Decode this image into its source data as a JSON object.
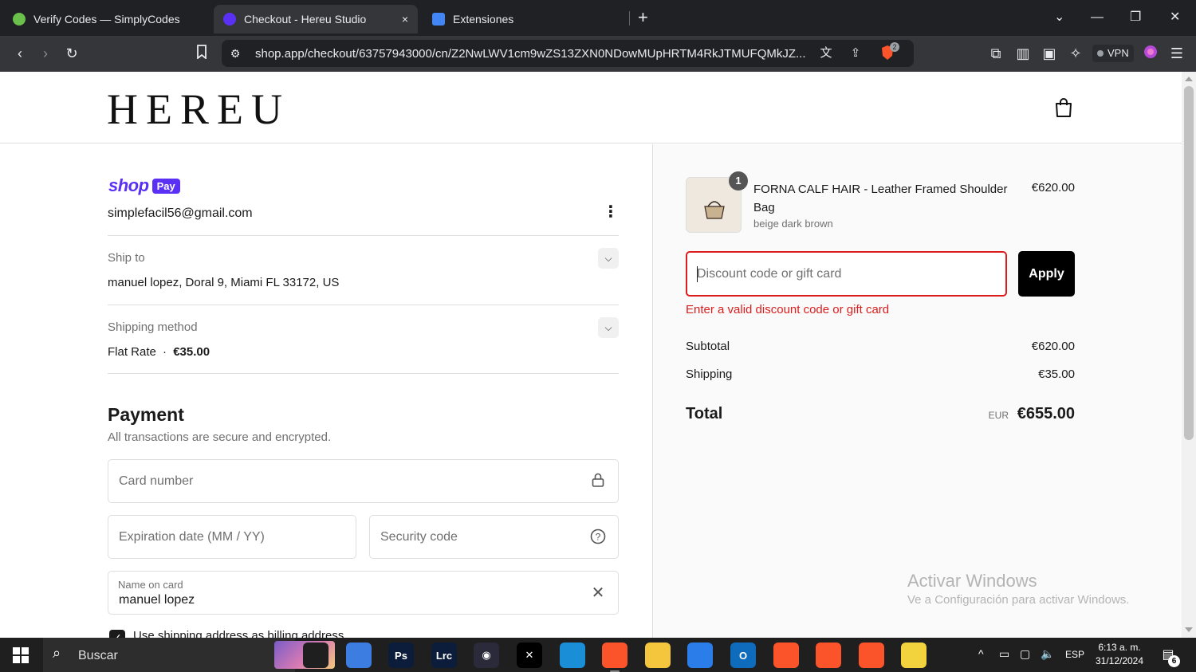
{
  "browser": {
    "tabs": [
      {
        "title": "Verify Codes — SimplyCodes",
        "active": false,
        "favicon_color": "#6bc04b"
      },
      {
        "title": "Checkout - Hereu Studio",
        "active": true,
        "favicon_color": "#5a31f4"
      },
      {
        "title": "Extensiones",
        "active": false,
        "favicon_color": "#4285f4"
      }
    ],
    "tab_close_icon": "×",
    "new_tab_icon": "+",
    "url": "shop.app/checkout/63757943000/cn/Z2NwLWV1cm9wZS13ZXN0NDowMUpHRTM4RkJTMUFQMkJZ...",
    "vpn_label": "VPN",
    "brave_badge": "2"
  },
  "site": {
    "logo": "HEREU"
  },
  "checkout": {
    "shop_pay": {
      "word": "shop",
      "pay": "Pay"
    },
    "email": "simplefacil56@gmail.com",
    "ship_to": {
      "label": "Ship to",
      "value": "manuel lopez, Doral 9, Miami FL 33172, US"
    },
    "shipping_method": {
      "label": "Shipping method",
      "name": "Flat Rate",
      "separator": "·",
      "price": "€35.00"
    },
    "payment": {
      "title": "Payment",
      "subtitle": "All transactions are secure and encrypted.",
      "card_number_placeholder": "Card number",
      "expiration_placeholder": "Expiration date (MM / YY)",
      "security_code_placeholder": "Security code",
      "name_label": "Name on card",
      "name_value": "manuel lopez",
      "billing_checkbox_label": "Use shipping address as billing address",
      "billing_checked": true
    }
  },
  "summary": {
    "item": {
      "quantity": "1",
      "title": "FORNA CALF HAIR - Leather Framed Shoulder Bag",
      "variant": "beige dark brown",
      "price": "€620.00"
    },
    "discount_placeholder": "Discount code or gift card",
    "apply_label": "Apply",
    "error": "Enter a valid discount code or gift card",
    "subtotal_label": "Subtotal",
    "subtotal_value": "€620.00",
    "shipping_label": "Shipping",
    "shipping_value": "€35.00",
    "total_label": "Total",
    "total_currency": "EUR",
    "total_value": "€655.00"
  },
  "watermark": {
    "line1": "Activar Windows",
    "line2": "Ve a Configuración para activar Windows."
  },
  "taskbar": {
    "search_label": "Buscar",
    "apps": [
      {
        "name": "task-view-icon",
        "label": "",
        "color": "#1f1f1f"
      },
      {
        "name": "copilot-icon",
        "label": "",
        "color": "#3b7de0"
      },
      {
        "name": "photoshop-icon",
        "label": "Ps",
        "color": "#0b1d3a"
      },
      {
        "name": "lightroom-classic-icon",
        "label": "Lrc",
        "color": "#0b1d3a"
      },
      {
        "name": "davinci-resolve-icon",
        "label": "◉",
        "color": "#2a2a3a"
      },
      {
        "name": "capcut-icon",
        "label": "✕",
        "color": "#000000"
      },
      {
        "name": "edge-icon",
        "label": "",
        "color": "#1a8fd8"
      },
      {
        "name": "brave-icon",
        "label": "",
        "color": "#fb542b"
      },
      {
        "name": "file-explorer-icon",
        "label": "",
        "color": "#f4c63d"
      },
      {
        "name": "microsoft-store-icon",
        "label": "",
        "color": "#2b7de9"
      },
      {
        "name": "outlook-icon",
        "label": "O",
        "color": "#0f6cbd"
      },
      {
        "name": "brave-icon-2",
        "label": "",
        "color": "#fb542b"
      },
      {
        "name": "brave-icon-3",
        "label": "",
        "color": "#fb542b"
      },
      {
        "name": "brave-icon-4",
        "label": "",
        "color": "#fb542b"
      },
      {
        "name": "sticky-app-icon",
        "label": "",
        "color": "#f3d33d"
      }
    ],
    "language": "ESP",
    "time": "6:13 a. m.",
    "date": "31/12/2024",
    "notification_count": "6"
  },
  "colors": {
    "shop_pay": "#5a31f4",
    "error": "#dd1d1d",
    "apply_bg": "#000000",
    "summary_bg": "#fafafa"
  }
}
